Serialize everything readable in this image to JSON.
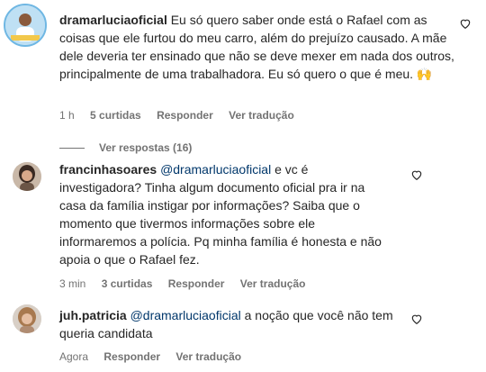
{
  "comments": [
    {
      "username": "dramarluciaoficial",
      "mention": "",
      "text": "Eu só quero saber onde está o Rafael com as coisas que ele furtou do meu carro, além do prejuízo causado. A mãe dele deveria ter ensinado que não se deve mexer em nada dos outros, principalmente de uma trabalhadora. Eu só quero o que é meu. 🙌",
      "time": "1 h",
      "likes": "5 curtidas",
      "reply": "Responder",
      "translate": "Ver tradução"
    },
    {
      "username": "francinhasoares",
      "mention": "@dramarluciaoficial",
      "text": "e vc é investigadora? Tinha algum documento oficial pra ir na casa da família instigar por informações? Saiba que o momento que tivermos informações sobre ele informaremos a polícia. Pq minha família é honesta e não apoia o que o Rafael fez.",
      "time": "3 min",
      "likes": "3 curtidas",
      "reply": "Responder",
      "translate": "Ver tradução"
    },
    {
      "username": "juh.patricia",
      "mention": "@dramarluciaoficial",
      "text": "a noção que você não tem queria candidata",
      "time": "Agora",
      "likes": "",
      "reply": "Responder",
      "translate": "Ver tradução"
    }
  ],
  "replies_toggle": "Ver respostas (16)",
  "icons": [
    "heart-icon"
  ]
}
